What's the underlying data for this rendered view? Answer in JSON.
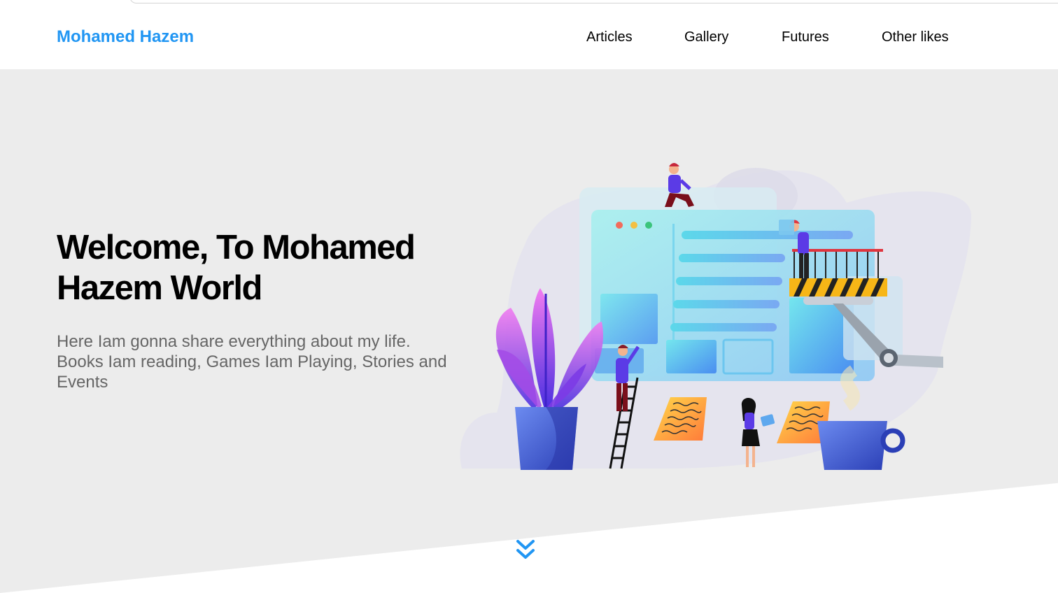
{
  "header": {
    "logo": "Mohamed Hazem",
    "nav": [
      {
        "label": "Articles"
      },
      {
        "label": "Gallery"
      },
      {
        "label": "Futures"
      },
      {
        "label": "Other likes"
      }
    ]
  },
  "hero": {
    "title": "Welcome, To Mohamed Hazem World",
    "description": "Here Iam gonna share everything about my life. Books Iam reading, Games Iam Playing, Stories and Events"
  },
  "icons": {
    "scroll": "double-chevron-down-icon"
  },
  "colors": {
    "brand": "#2196f3",
    "hero_background": "#ececec",
    "text_muted": "#666666"
  }
}
